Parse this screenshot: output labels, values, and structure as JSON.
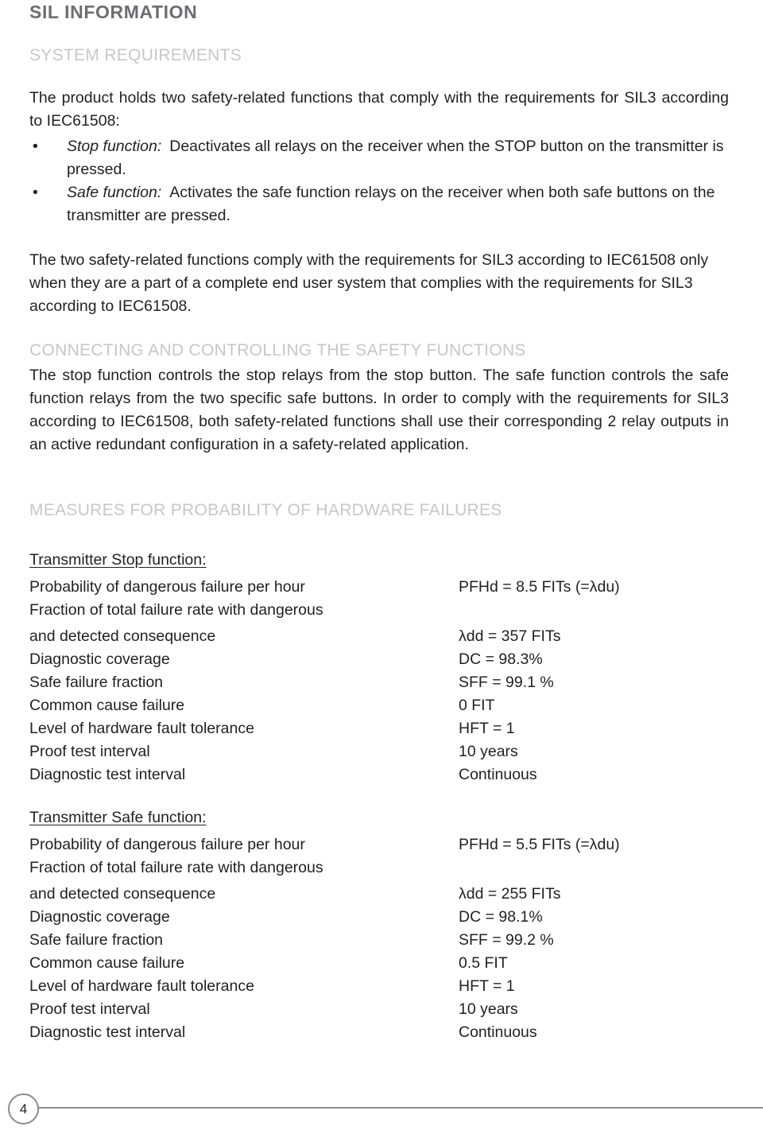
{
  "document": {
    "title": "SIL INFORMATION",
    "page_number": "4"
  },
  "sections": {
    "system_requirements": {
      "heading": "SYSTEM REQUIREMENTS",
      "intro": "The product holds two safety-related functions that comply with the requirements for SIL3 according to IEC61508:",
      "bullets": [
        {
          "marker": "•",
          "term": "Stop function:",
          "text": "Deactivates all relays on the receiver when the STOP button on the transmitter is pressed."
        },
        {
          "marker": "•",
          "term": "Safe function:",
          "text": "Activates the safe function relays on the receiver when both safe buttons on the transmitter are pressed."
        }
      ],
      "closing": "The two safety-related functions comply with the requirements for SIL3 according to IEC61508 only when they are a part of a complete end user system that complies with the requirements for SIL3 according to IEC61508."
    },
    "connecting": {
      "heading": "CONNECTING AND CONTROLLING THE SAFETY FUNCTIONS",
      "text": "The stop function controls the stop relays from the stop button. The safe function controls the safe function relays from the two specific safe buttons. In order to comply with the requirements for SIL3 according to IEC61508, both safety-related functions shall use their corresponding 2 relay outputs in an active redundant configuration in a safety-related application."
    },
    "measures": {
      "heading": "MEASURES FOR PROBABILITY OF HARDWARE FAILURES",
      "blocks": [
        {
          "title": "Transmitter Stop function:",
          "rows": [
            {
              "label": "Probability of dangerous failure per hour",
              "value": "PFHd = 8.5 FITs (=λdu)"
            },
            {
              "label": "Fraction of total failure rate with dangerous",
              "value": ""
            },
            {
              "label": "and detected consequence",
              "value": "λdd = 357 FITs"
            },
            {
              "label": "Diagnostic coverage",
              "value": "DC = 98.3%"
            },
            {
              "label": "Safe failure fraction",
              "value": "SFF = 99.1 %"
            },
            {
              "label": "Common cause failure",
              "value": "0 FIT"
            },
            {
              "label": "Level of hardware fault tolerance",
              "value": "HFT = 1"
            },
            {
              "label": "Proof test interval",
              "value": "10 years"
            },
            {
              "label": "Diagnostic test interval",
              "value": "Continuous"
            }
          ]
        },
        {
          "title": "Transmitter Safe function:",
          "rows": [
            {
              "label": "Probability of dangerous failure per hour",
              "value": "PFHd = 5.5 FITs (=λdu)"
            },
            {
              "label": "Fraction of total failure rate with dangerous",
              "value": ""
            },
            {
              "label": "and detected consequence",
              "value": "λdd = 255 FITs"
            },
            {
              "label": "Diagnostic coverage",
              "value": "DC = 98.1%"
            },
            {
              "label": "Safe failure fraction",
              "value": "SFF = 99.2 %"
            },
            {
              "label": "Common cause failure",
              "value": "0.5 FIT"
            },
            {
              "label": "Level of hardware fault tolerance",
              "value": "HFT = 1"
            },
            {
              "label": "Proof test interval",
              "value": "10 years"
            },
            {
              "label": "Diagnostic test interval",
              "value": "Continuous"
            }
          ]
        }
      ]
    }
  },
  "colors": {
    "body_text": "#231f20",
    "title_gray": "#6d6e71",
    "heading_gray": "#c6c7c9",
    "rule_gray": "#8c8c8c"
  }
}
